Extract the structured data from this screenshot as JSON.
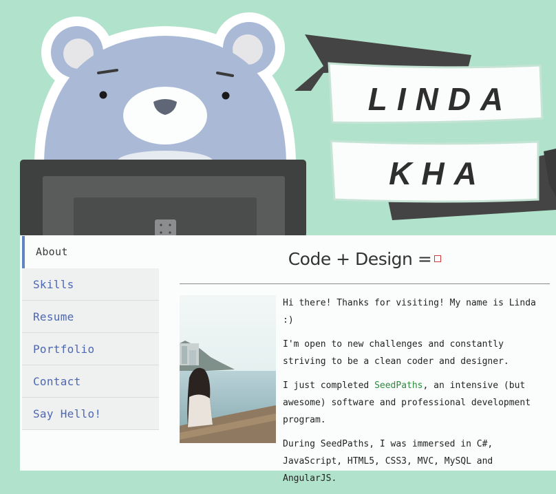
{
  "header": {
    "name_first": "LINDA",
    "name_last": "KHA"
  },
  "nav": {
    "items": [
      {
        "label": "About",
        "active": true
      },
      {
        "label": "Skills"
      },
      {
        "label": "Resume"
      },
      {
        "label": "Portfolio"
      },
      {
        "label": "Contact"
      },
      {
        "label": "Say Hello!"
      }
    ]
  },
  "main": {
    "heading": "Code + Design =",
    "p1": "Hi there! Thanks for visiting! My name is Linda :)",
    "p2": "I'm open to new challenges and constantly striving to be a clean coder and designer.",
    "p3_before": "I just completed ",
    "p3_link": "SeedPaths",
    "p3_after": ", an intensive (but awesome) software and professional development program.",
    "p4": "During SeedPaths, I was immersed in C#, JavaScript, HTML5, CSS3, MVC, MySQL and AngularJS."
  },
  "colors": {
    "background": "#b1e2cc",
    "bear": "#a9b9d6",
    "banner_dark": "#444444",
    "nav_link": "#4c67b5",
    "accent_bar": "#5f86c0",
    "link_green": "#2a8a3a",
    "heart": "#d03434"
  },
  "icons": {
    "heart": "heart-icon"
  }
}
